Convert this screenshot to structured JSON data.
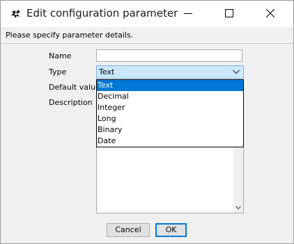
{
  "window": {
    "title": "Edit configuration parameter",
    "icon": "app-gear-icon"
  },
  "titlebar_controls": {
    "minimize": "minimize-icon",
    "maximize": "maximize-icon",
    "close": "close-icon"
  },
  "subtitle": "Please specify parameter details.",
  "form": {
    "name_label": "Name",
    "name_value": "",
    "type_label": "Type",
    "type_value": "Text",
    "default_label": "Default value",
    "description_label": "Description",
    "description_value": ""
  },
  "type_options": [
    "Text",
    "Decimal",
    "Integer",
    "Long",
    "Binary",
    "Date"
  ],
  "type_selected_index": 0,
  "buttons": {
    "cancel": "Cancel",
    "ok": "OK"
  },
  "colors": {
    "selection": "#0078d7",
    "combo_focus_bg": "#cce8ff"
  }
}
